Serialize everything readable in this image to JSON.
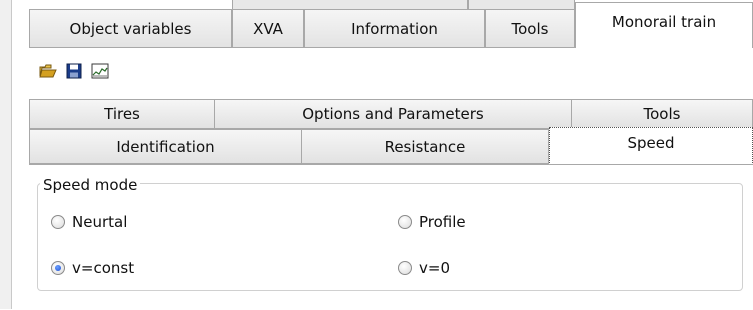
{
  "main_tabs": [
    "Object variables",
    "XVA",
    "Information",
    "Tools",
    "Monorail train"
  ],
  "active_main_tab": "Monorail train",
  "toolbar": {
    "items": [
      {
        "name": "open-folder-icon",
        "color": "#c8a020"
      },
      {
        "name": "save-icon",
        "color": "#1a3c8a"
      },
      {
        "name": "chart-icon",
        "color": "#3a6a3a"
      }
    ]
  },
  "inner_tabs": {
    "row1": [
      "Tires",
      "Options and Parameters",
      "Tools"
    ],
    "row2": [
      "Identification",
      "Resistance",
      "Speed"
    ]
  },
  "active_inner_tab": "Speed",
  "speed_mode": {
    "legend": "Speed mode",
    "options": [
      {
        "label": "Neurtal",
        "checked": false
      },
      {
        "label": "Profile",
        "checked": false
      },
      {
        "label": "v=const",
        "checked": true
      },
      {
        "label": "v=0",
        "checked": false
      }
    ]
  }
}
